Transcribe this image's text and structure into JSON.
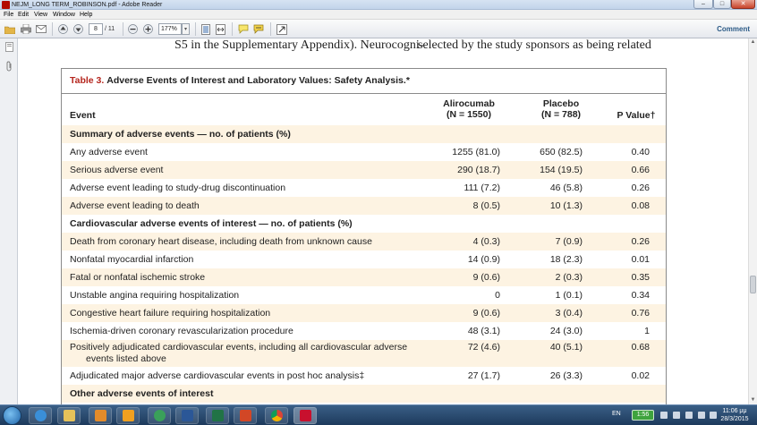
{
  "window": {
    "title": "NEJM_LONG TERM_ROBINSON.pdf - Adobe Reader",
    "min_label": "–",
    "max_label": "□",
    "close_label": "✕"
  },
  "menu": [
    "File",
    "Edit",
    "View",
    "Window",
    "Help"
  ],
  "toolbar": {
    "page_value": "8",
    "page_count": "/ 11",
    "zoom_value": "177%",
    "comment_label": "Comment"
  },
  "body_text": {
    "left": "S5 in the Supplementary Appendix). Neurocogni-",
    "right": "selected by the study sponsors as being related"
  },
  "table": {
    "title_num": "Table 3.",
    "title_text": "Adverse Events of Interest and Laboratory Values: Safety Analysis.*",
    "headers": {
      "event": "Event",
      "ali_name": "Alirocumab",
      "ali_n": "(N = 1550)",
      "pla_name": "Placebo",
      "pla_n": "(N = 788)",
      "p": "P Value†"
    },
    "rows": [
      {
        "event": "Summary of adverse events — no. of patients (%)",
        "ali": "",
        "pla": "",
        "p": ""
      },
      {
        "event": "Any adverse event",
        "ali": "1255 (81.0)",
        "pla": "650 (82.5)",
        "p": "0.40"
      },
      {
        "event": "Serious adverse event",
        "ali": "290 (18.7)",
        "pla": "154 (19.5)",
        "p": "0.66"
      },
      {
        "event": "Adverse event leading to study-drug discontinuation",
        "ali": "111 (7.2)",
        "pla": "46 (5.8)",
        "p": "0.26"
      },
      {
        "event": "Adverse event leading to death",
        "ali": "8 (0.5)",
        "pla": "10 (1.3)",
        "p": "0.08"
      },
      {
        "event": "Cardiovascular adverse events of interest — no. of patients (%)",
        "ali": "",
        "pla": "",
        "p": ""
      },
      {
        "event": "Death from coronary heart disease, including death from unknown cause",
        "ali": "4 (0.3)",
        "pla": "7 (0.9)",
        "p": "0.26"
      },
      {
        "event": "Nonfatal myocardial infarction",
        "ali": "14 (0.9)",
        "pla": "18 (2.3)",
        "p": "0.01"
      },
      {
        "event": "Fatal or nonfatal ischemic stroke",
        "ali": "9 (0.6)",
        "pla": "2 (0.3)",
        "p": "0.35"
      },
      {
        "event": "Unstable angina requiring hospitalization",
        "ali": "0",
        "pla": "1 (0.1)",
        "p": "0.34"
      },
      {
        "event": "Congestive heart failure requiring hospitalization",
        "ali": "9 (0.6)",
        "pla": "3 (0.4)",
        "p": "0.76"
      },
      {
        "event": "Ischemia-driven coronary revascularization procedure",
        "ali": "48 (3.1)",
        "pla": "24 (3.0)",
        "p": "1"
      },
      {
        "event": "Positively adjudicated cardiovascular events, including all cardiovascular adverse",
        "event2": "events listed above",
        "ali": "72 (4.6)",
        "pla": "40 (5.1)",
        "p": "0.68"
      },
      {
        "event": "Adjudicated major adverse cardiovascular events in post hoc analysis‡",
        "ali": "27 (1.7)",
        "pla": "26 (3.3)",
        "p": "0.02"
      },
      {
        "event": "Other adverse events of interest",
        "ali": "",
        "pla": "",
        "p": ""
      }
    ]
  },
  "taskbar": {
    "lang": "EN",
    "battery": "1:56",
    "time": "11:06 μμ",
    "date": "28/3/2015"
  }
}
